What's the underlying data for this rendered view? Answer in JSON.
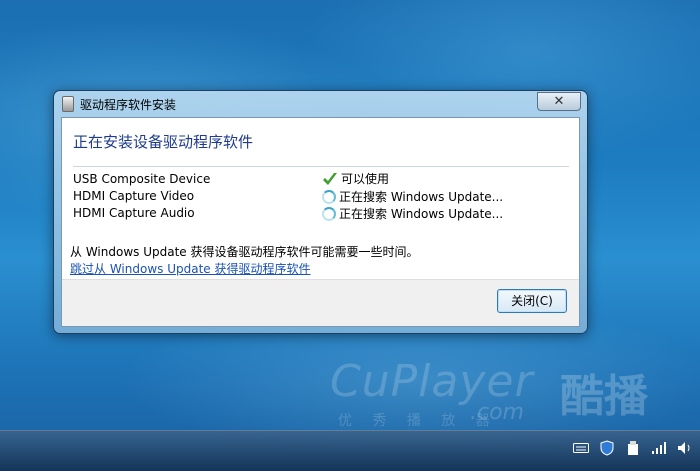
{
  "window": {
    "title": "驱动程序软件安装",
    "close_symbol": "✕",
    "heading": "正在安装设备驱动程序软件",
    "devices": [
      {
        "name": "USB Composite Device",
        "status": "可以使用",
        "status_icon": "check-icon"
      },
      {
        "name": "HDMI Capture Video",
        "status": "正在搜索 Windows Update...",
        "status_icon": "spinner-icon"
      },
      {
        "name": "HDMI Capture Audio",
        "status": "正在搜索 Windows Update...",
        "status_icon": "spinner-icon"
      }
    ],
    "info_text": "从 Windows Update 获得设备驱动程序软件可能需要一些时间。",
    "skip_link": "跳过从 Windows Update 获得驱动程序软件",
    "close_button": "关闭(C)"
  },
  "watermark": {
    "brand": "CuPlayer",
    "brand_cn": "酷播",
    "domain": ".com",
    "tagline": "优 秀 播 放 器"
  },
  "taskbar": {
    "tray_icons": [
      "keyboard-icon",
      "shield-icon",
      "usb-device-icon",
      "signal-icon",
      "volume-icon"
    ]
  },
  "colors": {
    "heading": "#1e3b8f",
    "link": "#1b52b5",
    "check": "#3f9e2c"
  }
}
